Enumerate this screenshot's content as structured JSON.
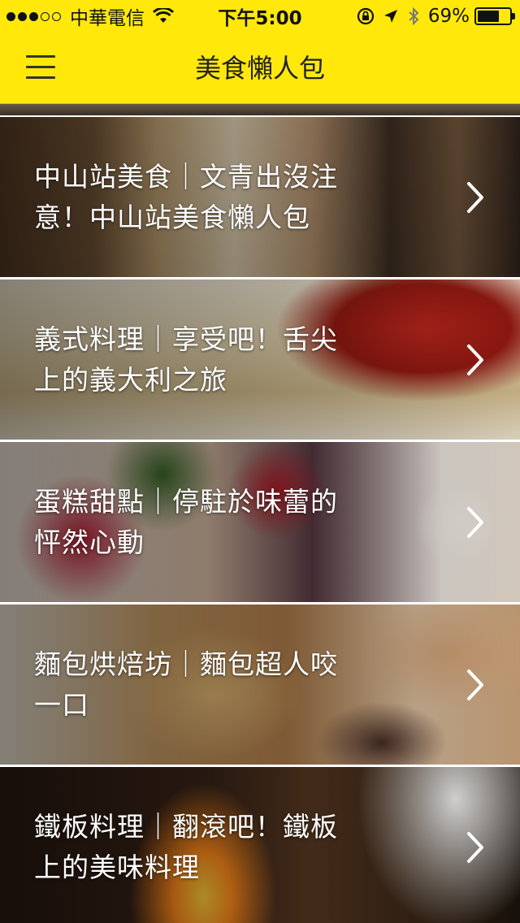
{
  "status_bar": {
    "carrier": "中華電信",
    "time": "下午5:00",
    "battery": "69%",
    "battery_level": 0.69,
    "signal_bars_filled": 3,
    "signal_bars_total": 5
  },
  "nav": {
    "title": "美食懶人包",
    "menu_icon": "hamburger-menu-icon"
  },
  "articles": [
    {
      "title": "中山站美食｜文青出沒注意！中山站美食懶人包"
    },
    {
      "title": "義式料理｜享受吧！舌尖上的義大利之旅"
    },
    {
      "title": "蛋糕甜點｜停駐於味蕾的怦然心動"
    },
    {
      "title": "麵包烘焙坊｜麵包超人咬一口"
    },
    {
      "title": "鐵板料理｜翻滾吧！鐵板上的美味料理"
    }
  ],
  "colors": {
    "header_bg": "#FFE80A",
    "title_text": "#ffffff"
  }
}
